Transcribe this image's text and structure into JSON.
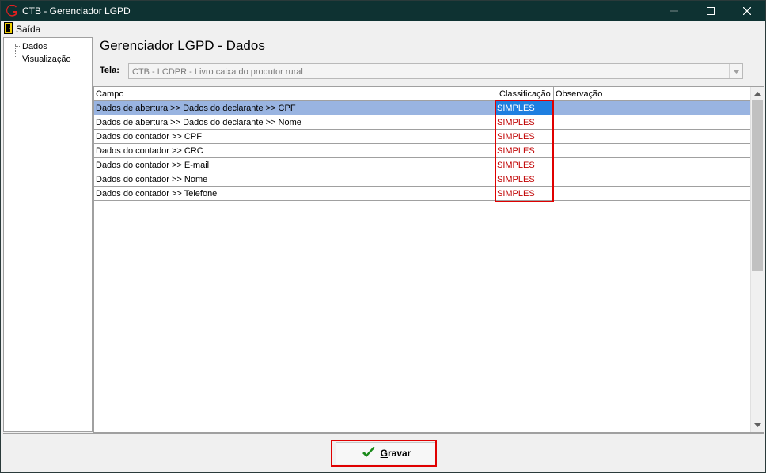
{
  "window": {
    "title": "CTB - Gerenciador LGPD",
    "accent_color": "#0e3232"
  },
  "menu": {
    "exit_label": "Saída"
  },
  "tree": {
    "items": [
      {
        "label": "Dados"
      },
      {
        "label": "Visualização"
      }
    ]
  },
  "main": {
    "title": "Gerenciador LGPD - Dados",
    "tela_label": "Tela:",
    "tela_value": "CTB - LCDPR - Livro caixa do produtor rural"
  },
  "grid": {
    "columns": [
      "Campo",
      "Classificação",
      "Observação"
    ],
    "rows": [
      {
        "campo": "Dados de abertura >>  Dados do declarante  >> CPF",
        "classificacao": "SIMPLES",
        "observacao": ""
      },
      {
        "campo": "Dados de abertura >>  Dados do declarante  >> Nome",
        "classificacao": "SIMPLES",
        "observacao": ""
      },
      {
        "campo": "Dados do contador >> CPF",
        "classificacao": "SIMPLES",
        "observacao": ""
      },
      {
        "campo": "Dados do contador >> CRC",
        "classificacao": "SIMPLES",
        "observacao": ""
      },
      {
        "campo": "Dados do contador >> E-mail",
        "classificacao": "SIMPLES",
        "observacao": ""
      },
      {
        "campo": "Dados do contador >> Nome",
        "classificacao": "SIMPLES",
        "observacao": ""
      },
      {
        "campo": "Dados do contador >> Telefone",
        "classificacao": "SIMPLES",
        "observacao": ""
      }
    ],
    "selected_row_color": "#99b4e1",
    "classification_color": "#c00000"
  },
  "footer": {
    "save_hotkey": "G",
    "save_rest": "ravar",
    "highlight_color": "#e00000"
  }
}
